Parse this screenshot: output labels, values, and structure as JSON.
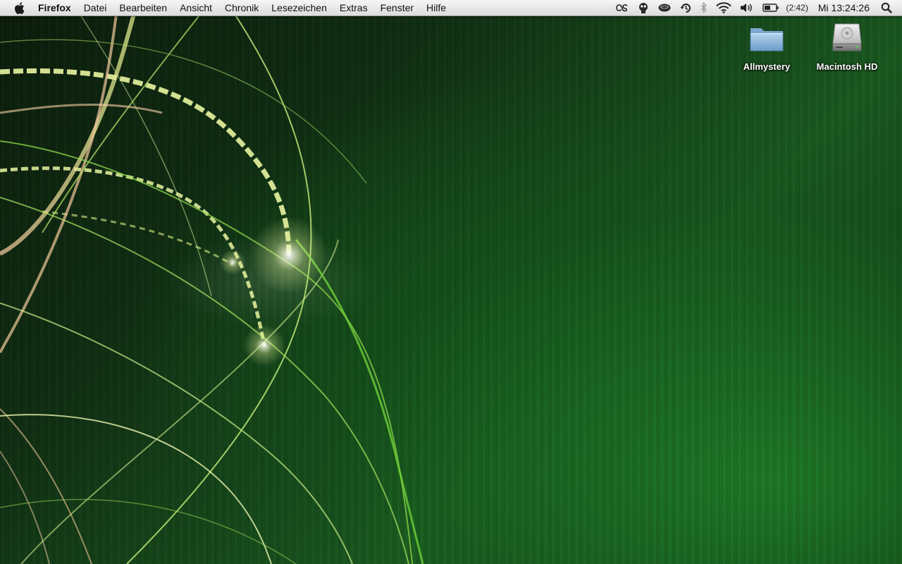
{
  "menubar": {
    "app_name": "Firefox",
    "items": [
      {
        "label": "Datei"
      },
      {
        "label": "Bearbeiten"
      },
      {
        "label": "Ansicht"
      },
      {
        "label": "Chronik"
      },
      {
        "label": "Lesezeichen"
      },
      {
        "label": "Extras"
      },
      {
        "label": "Fenster"
      },
      {
        "label": "Hilfe"
      }
    ],
    "status": {
      "icons": [
        "lastfm-icon",
        "growl-icon",
        "caffeine-icon",
        "time-machine-icon",
        "bluetooth-icon",
        "wifi-icon",
        "volume-icon",
        "battery-icon"
      ],
      "battery_time": "(2:42)",
      "clock": "Mi 13:24:26"
    }
  },
  "desktop": {
    "icons": [
      {
        "label": "Allmystery",
        "kind": "folder-icon"
      },
      {
        "label": "Macintosh HD",
        "kind": "hard-drive-icon"
      }
    ]
  },
  "colors": {
    "menubar_top": "#f6f6f6",
    "menubar_bottom": "#dcdcdc",
    "wallpaper_green": "#1b5a21",
    "wallpaper_dark": "#0c1c0c",
    "swirl_light": "#e8f5a0",
    "swirl_green": "#9be04a"
  }
}
